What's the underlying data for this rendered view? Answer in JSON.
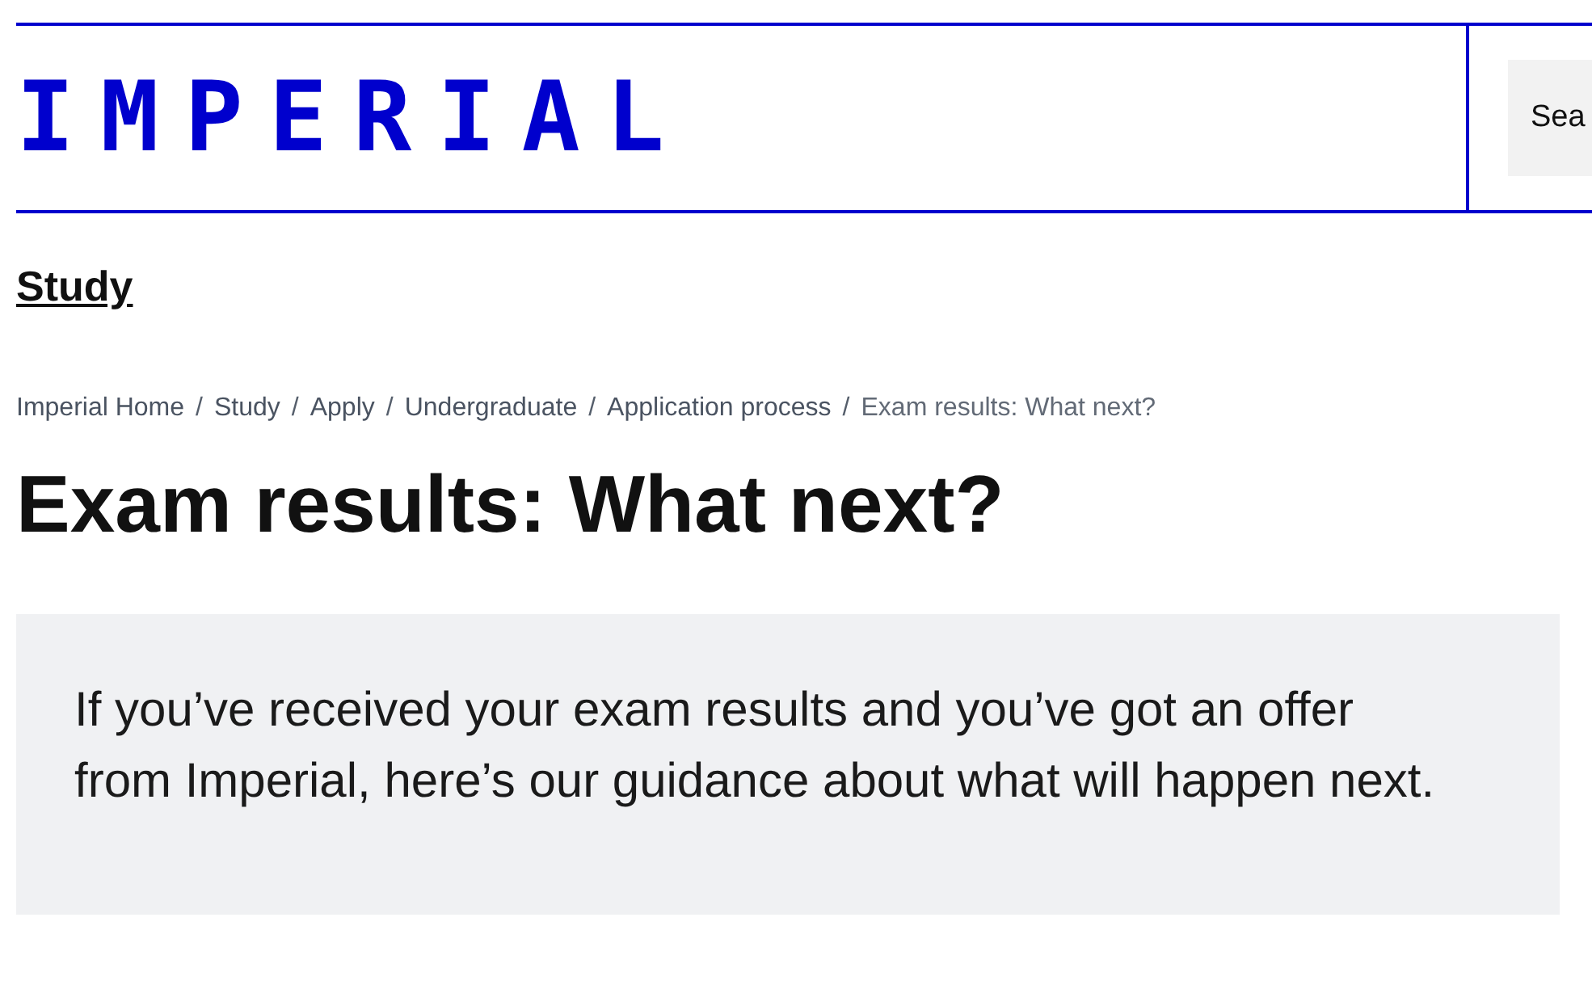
{
  "header": {
    "logo": "IMPERIAL",
    "search_button": "Sea"
  },
  "section_link": "Study",
  "breadcrumbs": {
    "separator": "/",
    "items": [
      {
        "label": "Imperial Home",
        "kind": "link"
      },
      {
        "label": "Study",
        "kind": "link"
      },
      {
        "label": "Apply",
        "kind": "link"
      },
      {
        "label": "Undergraduate",
        "kind": "link"
      },
      {
        "label": "Application process",
        "kind": "link"
      },
      {
        "label": "Exam results: What next?",
        "kind": "current"
      }
    ]
  },
  "title": "Exam results: What next?",
  "intro": "If you’ve received your exam results and you’ve got an offer from Imperial, here’s our guidance about what will happen next."
}
